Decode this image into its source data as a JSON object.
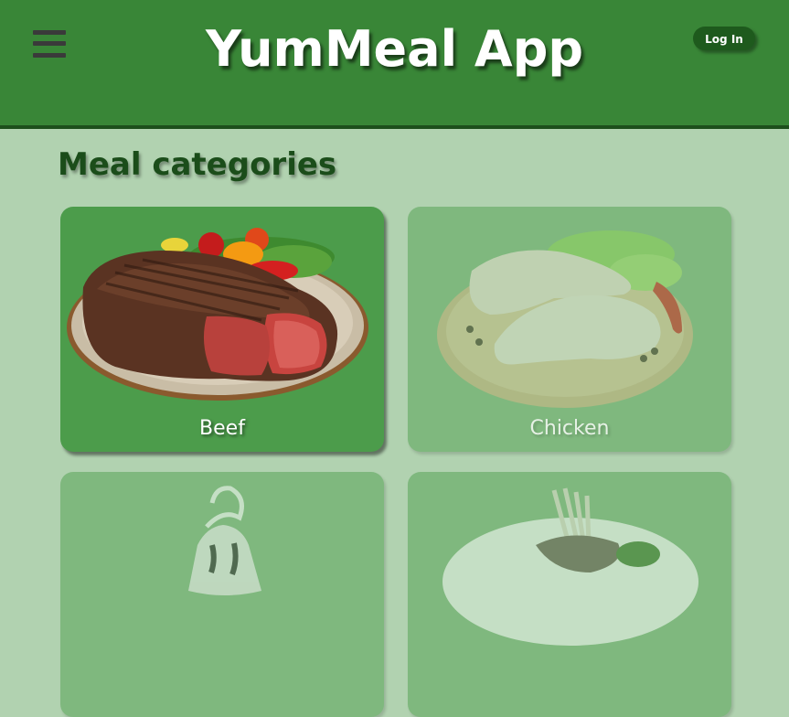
{
  "header": {
    "title": "YumMeal App",
    "login_label": "Log In",
    "menu_icon": "hamburger-menu-icon",
    "background_color": "#398637"
  },
  "main": {
    "section_title": "Meal categories",
    "categories": [
      {
        "label": "Beef",
        "state": "active",
        "image": "beef-steak-plate-image"
      },
      {
        "label": "Chicken",
        "state": "dimmed",
        "image": "raw-chicken-legs-board-image"
      },
      {
        "label": "",
        "state": "dimmed",
        "image": "dessert-image"
      },
      {
        "label": "",
        "state": "dimmed",
        "image": "lamb-rack-plate-image"
      }
    ]
  },
  "colors": {
    "page_background": "#b1d2b0",
    "card_active": "#4c9c4b",
    "card_dimmed": "#7fb87e",
    "login_button": "#1e5a1d",
    "section_title": "#1b4d1a"
  }
}
